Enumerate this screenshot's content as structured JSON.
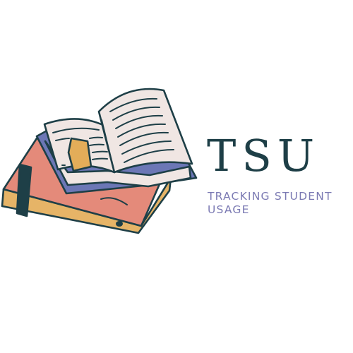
{
  "brand": {
    "name": "TSU",
    "tagline_lines": [
      "TRACKING STUDENT",
      "USAGE"
    ]
  },
  "icon": {
    "name": "open-book-stack-icon"
  },
  "colors": {
    "outline": "#1e3f47",
    "wordmark": "#1e3f47",
    "tagline": "#7b7ab3",
    "page": "#f0e6e3",
    "book_spine_blue": "#6c77b6",
    "book_cover_red": "#e48a7a",
    "book_edge_gold": "#e6b467",
    "image_block": "#e3ad59"
  }
}
